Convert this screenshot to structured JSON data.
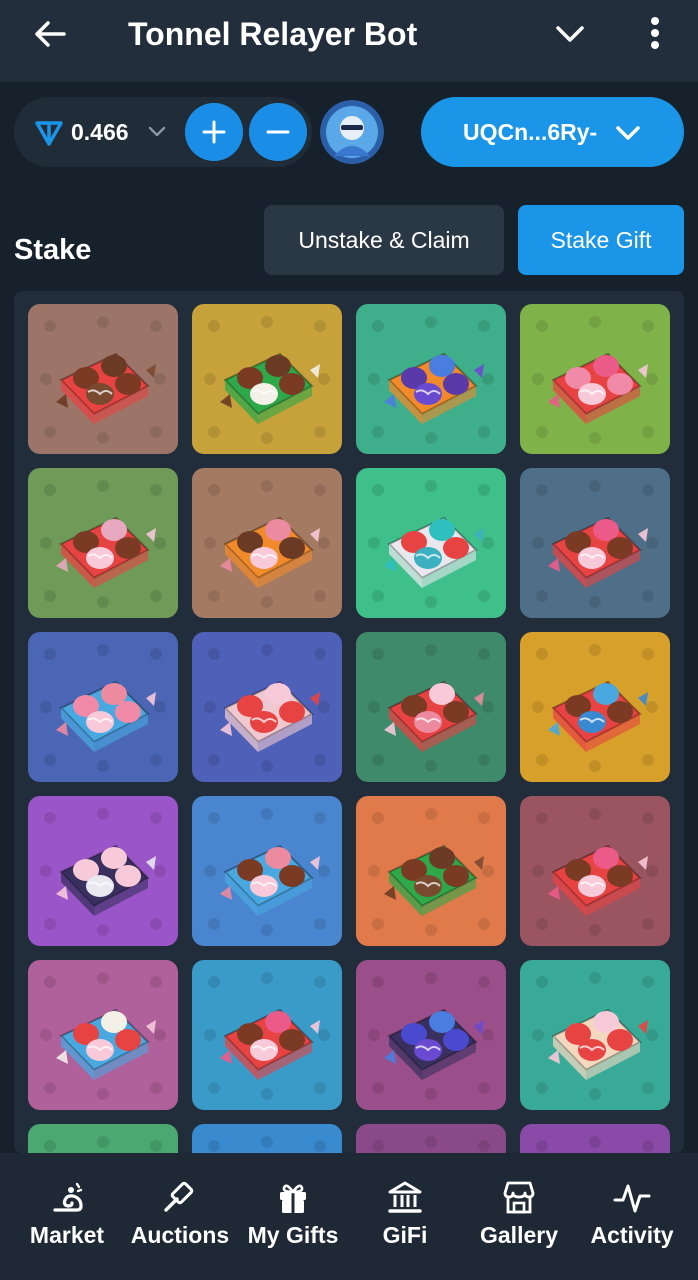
{
  "header": {
    "title": "Tonnel Relayer Bot",
    "back_icon": "arrow-left-icon",
    "collapse_icon": "chevron-down-icon",
    "menu_icon": "more-vertical-icon"
  },
  "wallet": {
    "balance": "0.466",
    "currency_icon": "ton-icon",
    "address": "UQCn...6Ry-"
  },
  "stake": {
    "title": "Stake",
    "unstake_label": "Unstake & Claim",
    "stake_gift_label": "Stake Gift"
  },
  "gifts": [
    {
      "bg": "#9c7568",
      "box": "#e84343",
      "a": "#7a3a24",
      "b": "#6b3a24",
      "c": "#7a4a30"
    },
    {
      "bg": "#c7a23b",
      "box": "#2fa84a",
      "a": "#7a3a24",
      "b": "#6b3a24",
      "c": "#f3f0e8"
    },
    {
      "bg": "#3fae8a",
      "box": "#f08a2a",
      "a": "#5a3aa8",
      "b": "#4a7de0",
      "c": "#6a4ad0"
    },
    {
      "bg": "#7fb34a",
      "box": "#e84343",
      "a": "#f08aa8",
      "b": "#ec5a8a",
      "c": "#f7c9d9"
    },
    {
      "bg": "#6f9a57",
      "box": "#e84343",
      "a": "#7a3a24",
      "b": "#e8a8c0",
      "c": "#f7c9d9"
    },
    {
      "bg": "#a57a63",
      "box": "#f08a2a",
      "a": "#6b3a24",
      "b": "#ec8aa0",
      "c": "#f7c9d9"
    },
    {
      "bg": "#3fbf8a",
      "box": "#e8e8ee",
      "a": "#e84343",
      "b": "#2fbfbf",
      "c": "#3ab0c0"
    },
    {
      "bg": "#4f6f88",
      "box": "#e84343",
      "a": "#7a3a24",
      "b": "#ec5a8a",
      "c": "#f7c9d9"
    },
    {
      "bg": "#4a66b5",
      "box": "#4aa8e0",
      "a": "#f08aa8",
      "b": "#ec8aa0",
      "c": "#f7c9d9"
    },
    {
      "bg": "#4e60b8",
      "box": "#f0c8d0",
      "a": "#e84343",
      "b": "#f7c9d9",
      "c": "#e84343"
    },
    {
      "bg": "#3f8a6a",
      "box": "#e84343",
      "a": "#7a3a24",
      "b": "#f7c9d9",
      "c": "#ec8aa0"
    },
    {
      "bg": "#d7a02a",
      "box": "#e84343",
      "a": "#7a3a24",
      "b": "#4aa8e0",
      "c": "#3a88d0"
    },
    {
      "bg": "#9a55c8",
      "box": "#3a3060",
      "a": "#f7c9d9",
      "b": "#f7c9d9",
      "c": "#e8e8ee"
    },
    {
      "bg": "#4a86d0",
      "box": "#4aa8e0",
      "a": "#7a3a24",
      "b": "#ec8aa0",
      "c": "#f7c9d9"
    },
    {
      "bg": "#e07a4a",
      "box": "#2fa84a",
      "a": "#7a3a24",
      "b": "#6b3a24",
      "c": "#7a4a30"
    },
    {
      "bg": "#9a5560",
      "box": "#e84343",
      "a": "#7a3a24",
      "b": "#ec5a8a",
      "c": "#f7c9d9"
    },
    {
      "bg": "#b0609a",
      "box": "#4aa8e0",
      "a": "#e84343",
      "b": "#f3f0e8",
      "c": "#f7c9d9"
    },
    {
      "bg": "#3a9ac8",
      "box": "#e84343",
      "a": "#7a3a24",
      "b": "#ec5a8a",
      "c": "#f7c9d9"
    },
    {
      "bg": "#9a4f8a",
      "box": "#3a3060",
      "a": "#4a4ad0",
      "b": "#4a7de0",
      "c": "#6a4ad0"
    },
    {
      "bg": "#3aaa98",
      "box": "#f3d8c0",
      "a": "#e84343",
      "b": "#f7c9d9",
      "c": "#e84343"
    },
    {
      "bg": "#4aa870",
      "box": "#e84343",
      "a": "#7a3a24",
      "b": "#6b3a24",
      "c": "#f3f0e8"
    },
    {
      "bg": "#3a8ad0",
      "box": "#4aa8e0",
      "a": "#7a3a24",
      "b": "#ec8aa0",
      "c": "#f7c9d9"
    },
    {
      "bg": "#8a4a8a",
      "box": "#3a3060",
      "a": "#4a4ad0",
      "b": "#4a7de0",
      "c": "#6a4ad0"
    },
    {
      "bg": "#8a4aa8",
      "box": "#f08a2a",
      "a": "#7a3a24",
      "b": "#ec8aa0",
      "c": "#f7c9d9"
    }
  ],
  "nav": [
    {
      "label": "Market",
      "icon": "market-icon"
    },
    {
      "label": "Auctions",
      "icon": "gavel-icon"
    },
    {
      "label": "My Gifts",
      "icon": "gift-icon"
    },
    {
      "label": "GiFi",
      "icon": "bank-icon"
    },
    {
      "label": "Gallery",
      "icon": "storefront-icon"
    },
    {
      "label": "Activity",
      "icon": "pulse-icon"
    }
  ]
}
